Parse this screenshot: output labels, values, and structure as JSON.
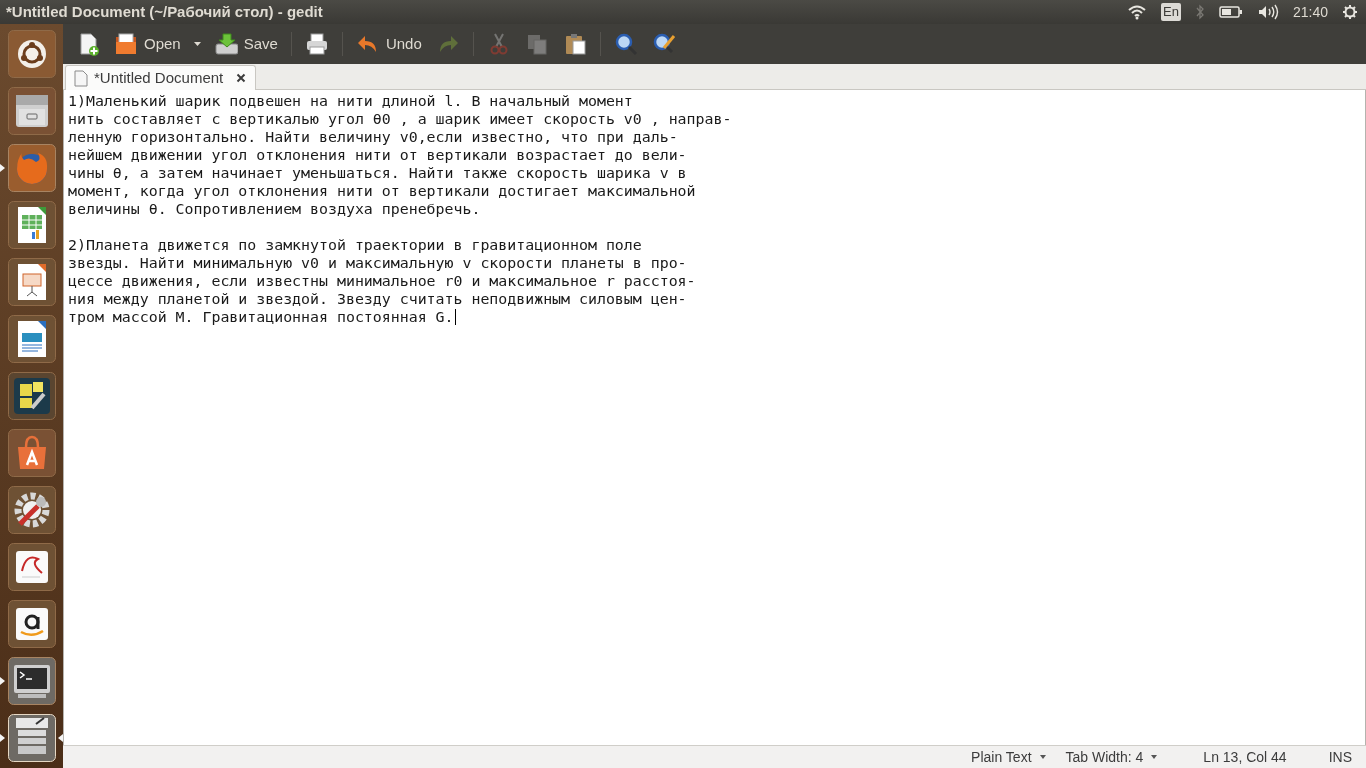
{
  "window": {
    "title": "*Untitled Document (~/Рабочий стол) - gedit"
  },
  "top_panel": {
    "keyboard_layout": "En",
    "clock": "21:40"
  },
  "launcher": [
    {
      "kind": "dash",
      "running": false,
      "focused": false
    },
    {
      "kind": "files",
      "running": false,
      "focused": false
    },
    {
      "kind": "browser",
      "running": true,
      "focused": false
    },
    {
      "kind": "spreadsheet",
      "running": false,
      "focused": false
    },
    {
      "kind": "presentation",
      "running": false,
      "focused": false
    },
    {
      "kind": "writer",
      "running": false,
      "focused": false
    },
    {
      "kind": "tools",
      "running": false,
      "focused": false
    },
    {
      "kind": "store",
      "running": false,
      "focused": false
    },
    {
      "kind": "settings",
      "running": false,
      "focused": false
    },
    {
      "kind": "reader",
      "running": false,
      "focused": false
    },
    {
      "kind": "shop",
      "running": false,
      "focused": false
    },
    {
      "kind": "terminal",
      "running": true,
      "focused": false
    },
    {
      "kind": "editor",
      "running": true,
      "focused": true
    }
  ],
  "toolbar": [
    {
      "kind": "new",
      "disabled": false
    },
    {
      "kind": "open",
      "label": "Open",
      "disabled": false,
      "dropdown": true
    },
    {
      "kind": "save",
      "label": "Save",
      "disabled": false
    },
    {
      "kind": "print",
      "disabled": false
    },
    {
      "kind": "undo",
      "label": "Undo",
      "disabled": false
    },
    {
      "kind": "redo",
      "disabled": true
    },
    {
      "kind": "cut",
      "disabled": true
    },
    {
      "kind": "copy",
      "disabled": true
    },
    {
      "kind": "paste",
      "disabled": false
    },
    {
      "kind": "find",
      "disabled": false
    },
    {
      "kind": "replace",
      "disabled": false
    }
  ],
  "tabs": [
    {
      "label": "*Untitled Document",
      "selected": true
    }
  ],
  "editor": {
    "paragraphs": [
      [
        "1)Маленький шарик подвешен на нити длиной l. В начальный момент",
        "нить составляет с вертикалью угол θ0 , а шарик имеет скорость v0 , направ-",
        "ленную горизонтально. Найти величину v0,если известно, что при даль-",
        "нейшем движении угол отклонения нити от вертикали возрастает до вели-",
        "чины θ, а затем начинает уменьшаться. Найти также скорость шарика v в",
        "момент, когда угол отклонения нити от вертикали достигает максимальной",
        "величины θ. Сопротивлением воздуха пренебречь."
      ],
      [
        "2)Планета движется по замкнутой траектории в гравитационном поле",
        "звезды. Найти минимальную v0 и максимальную v скорости планеты в про-",
        "цессе движения, если известны минимальное r0 и максимальное r расстоя-",
        "ния между планетой и звездой. Звезду считать неподвижным силовым цен-",
        "тром массой M. Гравитационная постоянная G."
      ]
    ]
  },
  "status_bar": {
    "language": "Plain Text",
    "tab_width": "Tab Width: 4",
    "position": "Ln 13, Col 44",
    "mode": "INS"
  }
}
